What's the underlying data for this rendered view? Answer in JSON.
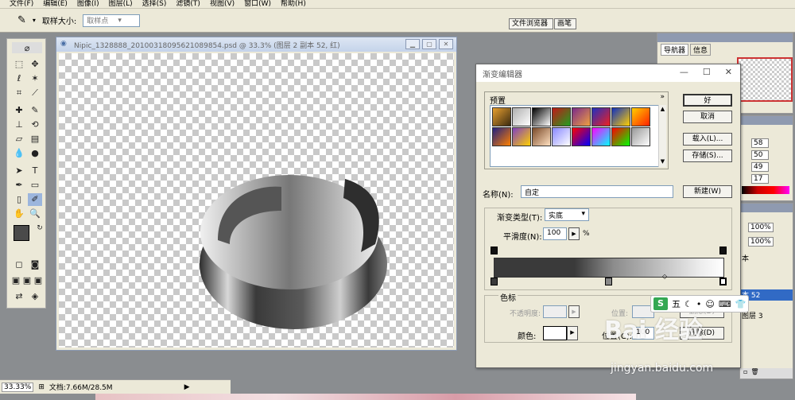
{
  "menu": [
    "文件(F)",
    "编辑(E)",
    "图像(I)",
    "图层(L)",
    "选择(S)",
    "滤镜(T)",
    "视图(V)",
    "窗口(W)",
    "帮助(H)"
  ],
  "options": {
    "sample_size_label": "取样大小:",
    "sample_size_value": "取样点"
  },
  "dock_tabs": [
    "文件浏览器",
    "画笔"
  ],
  "document": {
    "title": "Nipic_1328888_20100318095621089854.psd @ 33.3% (图层 2 副本 52, 红)"
  },
  "status": {
    "zoom": "33.33%",
    "doc_info": "文档:7.66M/28.5M"
  },
  "gradient_editor": {
    "title": "渐变编辑器",
    "presets_label": "预置",
    "presets_arrow": "»",
    "ok": "好",
    "cancel": "取消",
    "load": "载入(L)...",
    "save": "存储(S)...",
    "name_label": "名称(N):",
    "name_value": "自定",
    "new_button": "新建(W)",
    "gradient_type_label": "渐变类型(T):",
    "gradient_type_value": "实底",
    "smoothness_label": "平滑度(N):",
    "smoothness_value": "100",
    "percent": "%",
    "stops_label": "色标",
    "opacity_label": "不透明度:",
    "position_label": "位置:",
    "delete_button": "删除(D)",
    "color_label": "颜色:",
    "position_c_label": "位置(C):",
    "position_c_value": "100",
    "delete_d": "删除(D)",
    "preset_colors": [
      [
        "#e8a030",
        "#3a2a10"
      ],
      [
        "#b0b0b0",
        "#ffffff"
      ],
      [
        "#000000",
        "#ffffff"
      ],
      [
        "#c01818",
        "#20a020"
      ],
      [
        "#7a2a8a",
        "#f0a040"
      ],
      [
        "#2030c0",
        "#f02020"
      ],
      [
        "#1030c0",
        "#ffd000"
      ],
      [
        "#ffd000",
        "#ff2000"
      ],
      [
        "#202080",
        "#ff8000"
      ],
      [
        "#8040c0",
        "#ffd000"
      ],
      [
        "#7a4a2a",
        "#ffe0c0"
      ],
      [
        "#8888ff",
        "#ffffff"
      ],
      [
        "#ff0000",
        "#0000ff"
      ],
      [
        "#ff00ff",
        "#00ffff"
      ],
      [
        "#ff0000",
        "#00ff00"
      ],
      [
        "#999999",
        "#ffffff"
      ]
    ]
  },
  "navigator": {
    "tab1": "导航器",
    "tab2": "信息"
  },
  "color_values": [
    "58",
    "50",
    "49",
    "17"
  ],
  "layers": {
    "opacity1": "100%",
    "opacity2": "100%",
    "item1": "本",
    "item2": "本 52",
    "item3": "图层 3"
  },
  "ime": {
    "logo": "S",
    "mode": "五"
  },
  "watermark": {
    "brand": "Bai 经验",
    "url": "jingyan.baidu.com"
  }
}
